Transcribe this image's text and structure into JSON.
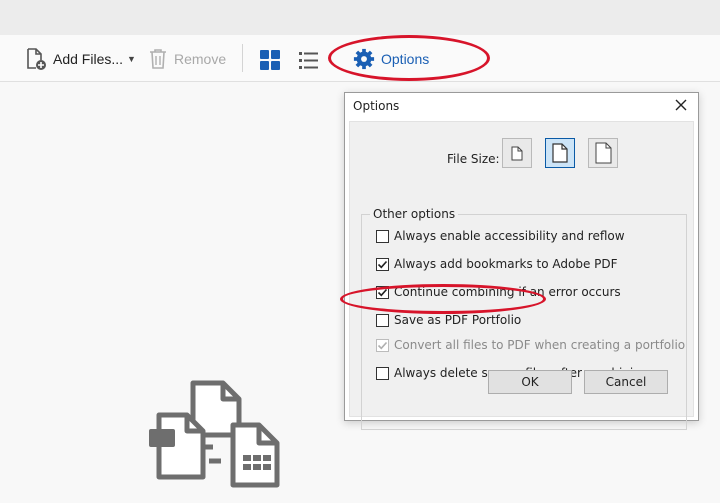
{
  "toolbar": {
    "add_files_label": "Add Files...",
    "remove_label": "Remove",
    "options_label": "Options"
  },
  "dialog": {
    "title": "Options",
    "file_size_label": "File Size:",
    "group_title": "Other options",
    "options": [
      {
        "label": "Always enable accessibility and reflow",
        "checked": false,
        "disabled": false
      },
      {
        "label": "Always add bookmarks to Adobe PDF",
        "checked": true,
        "disabled": false
      },
      {
        "label": "Continue combining if an error occurs",
        "checked": true,
        "disabled": false
      },
      {
        "label": "Save as PDF Portfolio",
        "checked": false,
        "disabled": false
      },
      {
        "label": "Convert all files to PDF when creating a portfolio",
        "checked": true,
        "disabled": true
      },
      {
        "label": "Always delete source files after combining",
        "checked": false,
        "disabled": false
      }
    ],
    "ok_label": "OK",
    "cancel_label": "Cancel"
  },
  "colors": {
    "accent": "#1a5fb4",
    "highlight": "#d7142a"
  }
}
